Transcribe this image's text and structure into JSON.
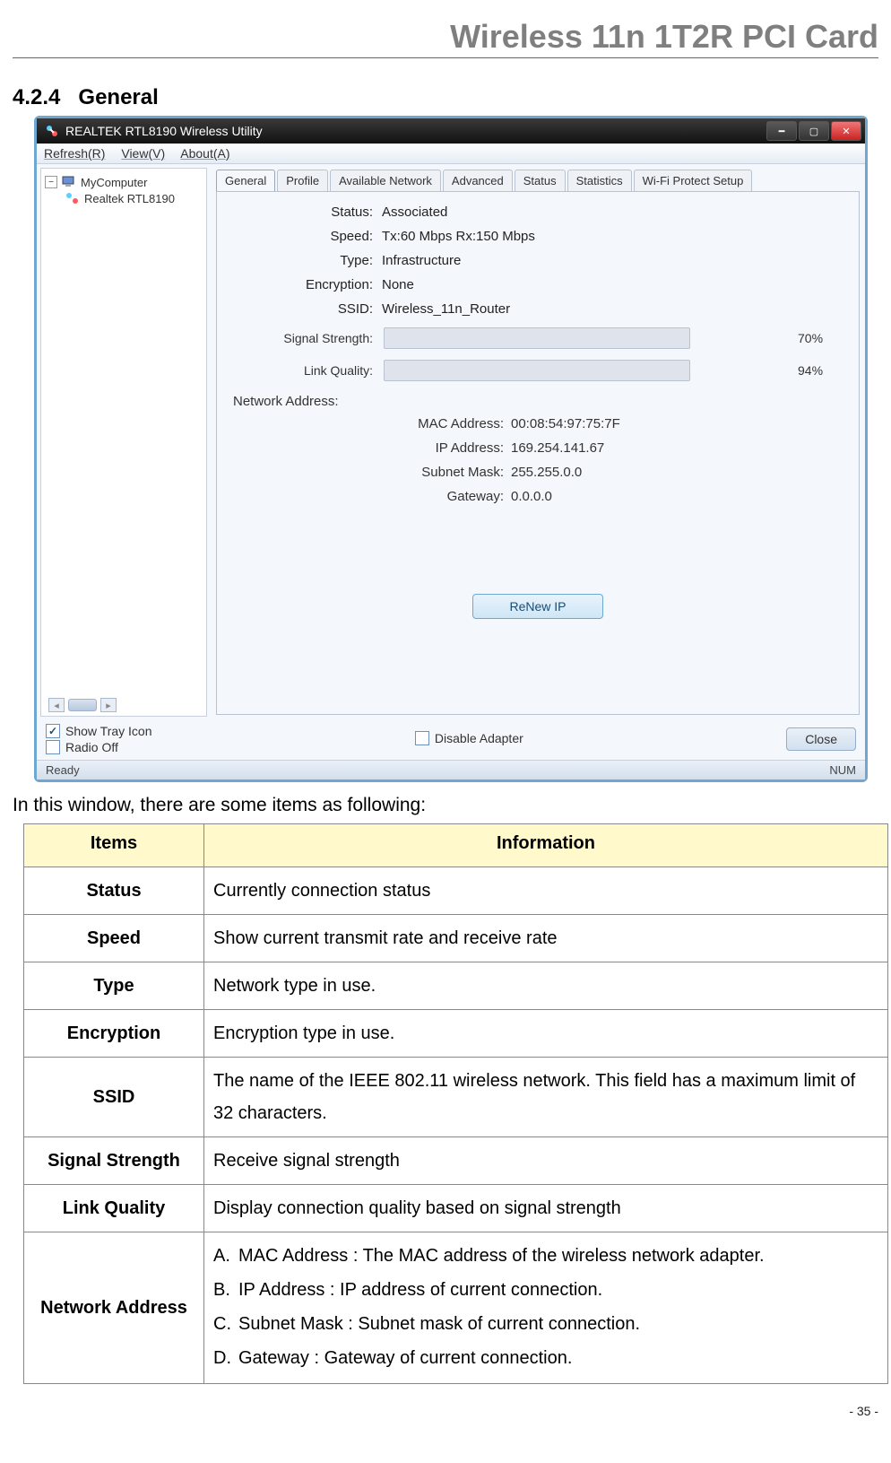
{
  "header": {
    "title": "Wireless 11n 1T2R PCI Card"
  },
  "section": {
    "num": "4.2.4",
    "name": "General"
  },
  "win": {
    "title": "REALTEK RTL8190 Wireless Utility",
    "menu": {
      "refresh": "Refresh(R)",
      "view": "View(V)",
      "about": "About(A)"
    },
    "tree": {
      "root": "MyComputer",
      "sub": "Realtek RTL8190"
    },
    "tabs": {
      "general": "General",
      "profile": "Profile",
      "avail": "Available Network",
      "advanced": "Advanced",
      "status": "Status",
      "stats": "Statistics",
      "wps": "Wi-Fi Protect Setup"
    },
    "fields": {
      "status_l": "Status:",
      "status_v": "Associated",
      "speed_l": "Speed:",
      "speed_v": "Tx:60 Mbps Rx:150 Mbps",
      "type_l": "Type:",
      "type_v": "Infrastructure",
      "enc_l": "Encryption:",
      "enc_v": "None",
      "ssid_l": "SSID:",
      "ssid_v": "Wireless_11n_Router"
    },
    "bars": {
      "ss_l": "Signal Strength:",
      "ss_pct": "70%",
      "lq_l": "Link Quality:",
      "lq_pct": "94%"
    },
    "net": {
      "title": "Network Address:",
      "mac_l": "MAC Address:",
      "mac_v": "00:08:54:97:75:7F",
      "ip_l": "IP Address:",
      "ip_v": "169.254.141.67",
      "mask_l": "Subnet Mask:",
      "mask_v": "255.255.0.0",
      "gw_l": "Gateway:",
      "gw_v": "0.0.0.0"
    },
    "renew": "ReNew IP",
    "opts": {
      "tray": "Show Tray Icon",
      "radio": "Radio Off",
      "disable": "Disable Adapter",
      "close": "Close"
    },
    "statusbar": {
      "ready": "Ready",
      "num": "NUM"
    }
  },
  "intro": "In this window, there are some items as following:",
  "table": {
    "h_items": "Items",
    "h_info": "Information",
    "rows": {
      "status_k": "Status",
      "status_v": "Currently connection status",
      "speed_k": "Speed",
      "speed_v": "Show current transmit rate and receive rate",
      "type_k": "Type",
      "type_v": "Network type in use.",
      "enc_k": "Encryption",
      "enc_v": "Encryption type in use.",
      "ssid_k": "SSID",
      "ssid_v": "The name of the IEEE 802.11 wireless network. This field has a maximum limit of 32 characters.",
      "ss_k": "Signal Strength",
      "ss_v": "Receive signal strength",
      "lq_k": "Link Quality",
      "lq_v": "Display connection quality based on signal strength",
      "na_k": "Network Address",
      "na_a": "MAC Address : The MAC address of the wireless network adapter.",
      "na_b": "IP Address : IP address of current connection.",
      "na_c": "Subnet Mask : Subnet mask of current connection.",
      "na_d": "Gateway : Gateway of current connection."
    }
  },
  "page_num": "- 35 -"
}
